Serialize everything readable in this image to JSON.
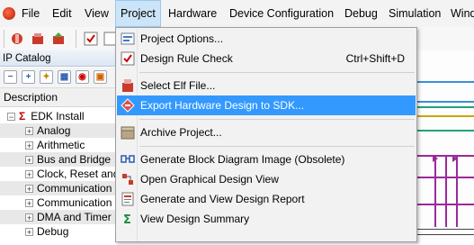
{
  "menubar": {
    "items": [
      {
        "id": "file",
        "label": "File"
      },
      {
        "id": "edit",
        "label": "Edit"
      },
      {
        "id": "view",
        "label": "View"
      },
      {
        "id": "project",
        "label": "Project"
      },
      {
        "id": "hardware",
        "label": "Hardware"
      },
      {
        "id": "device-configuration",
        "label": "Device Configuration"
      },
      {
        "id": "debug",
        "label": "Debug"
      },
      {
        "id": "simulation",
        "label": "Simulation"
      },
      {
        "id": "window",
        "label": "Wind"
      }
    ],
    "active": "Project"
  },
  "ip_catalog": {
    "title": "IP Catalog",
    "column_header": "Description",
    "root": "EDK Install",
    "items": [
      "Analog",
      "Arithmetic",
      "Bus and Bridge",
      "Clock, Reset and",
      "Communication",
      "Communication",
      "DMA and Timer",
      "Debug"
    ]
  },
  "project_menu": {
    "items": [
      {
        "label": "Project Options...",
        "icon": "options-icon",
        "shortcut": ""
      },
      {
        "label": "Design Rule Check",
        "icon": "drc-icon",
        "shortcut": "Ctrl+Shift+D"
      },
      {
        "label": "Select Elf File...",
        "icon": "elf-icon",
        "shortcut": ""
      },
      {
        "label": "Export Hardware Design to SDK...",
        "icon": "export-icon",
        "shortcut": "",
        "highlighted": true
      },
      {
        "label": "Archive Project...",
        "icon": "archive-icon",
        "shortcut": ""
      },
      {
        "label": "Generate Block Diagram Image (Obsolete)",
        "icon": "block-diagram-icon",
        "shortcut": ""
      },
      {
        "label": "Open Graphical Design View",
        "icon": "graphical-view-icon",
        "shortcut": ""
      },
      {
        "label": "Generate and View Design Report",
        "icon": "report-icon",
        "shortcut": ""
      },
      {
        "label": "View Design Summary",
        "icon": "summary-icon",
        "shortcut": ""
      }
    ]
  },
  "colors": {
    "highlight": "#3399ff",
    "menu_active": "#cce4f7",
    "menu_bg": "#f2f2f2"
  }
}
